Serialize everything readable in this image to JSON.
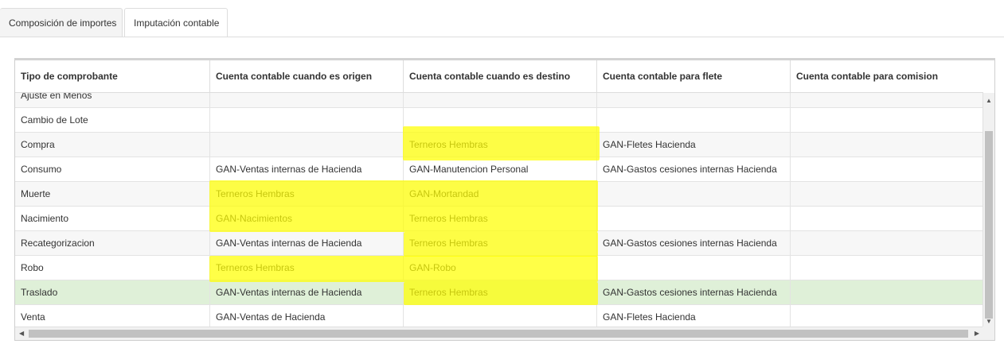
{
  "tabs": [
    {
      "label": "Composición de importes",
      "active": false
    },
    {
      "label": "Imputación contable",
      "active": true
    }
  ],
  "table": {
    "columns": [
      "Tipo de comprobante",
      "Cuenta contable cuando es origen",
      "Cuenta contable cuando es destino",
      "Cuenta contable para flete",
      "Cuenta contable para comision"
    ],
    "rows": [
      [
        "Ajuste en Menos",
        "",
        "",
        "",
        ""
      ],
      [
        "Cambio de Lote",
        "",
        "",
        "",
        ""
      ],
      [
        "Compra",
        "",
        "Terneros Hembras",
        "GAN-Fletes Hacienda",
        ""
      ],
      [
        "Consumo",
        "GAN-Ventas internas de Hacienda",
        "GAN-Manutencion Personal",
        "GAN-Gastos cesiones internas Hacienda",
        ""
      ],
      [
        "Muerte",
        "Terneros Hembras",
        "GAN-Mortandad",
        "",
        ""
      ],
      [
        "Nacimiento",
        "GAN-Nacimientos",
        "Terneros Hembras",
        "",
        ""
      ],
      [
        "Recategorizacion",
        "GAN-Ventas internas de Hacienda",
        "Terneros Hembras",
        "GAN-Gastos cesiones internas Hacienda",
        ""
      ],
      [
        "Robo",
        "Terneros Hembras",
        "GAN-Robo",
        "",
        ""
      ],
      [
        "Traslado",
        "GAN-Ventas internas de Hacienda",
        "Terneros Hembras",
        "GAN-Gastos cesiones internas Hacienda",
        ""
      ],
      [
        "Venta",
        "GAN-Ventas de Hacienda",
        "",
        "GAN-Fletes Hacienda",
        ""
      ]
    ],
    "selected_row": "Traslado"
  },
  "colors": {
    "highlight": "#ffff00",
    "selected_row": "#dff0d8",
    "alt_row": "#f7f7f7"
  },
  "icons": {
    "scroll_up": "scroll-up-arrow-icon",
    "scroll_down": "scroll-down-arrow-icon",
    "scroll_left": "scroll-left-arrow-icon",
    "scroll_right": "scroll-right-arrow-icon"
  }
}
